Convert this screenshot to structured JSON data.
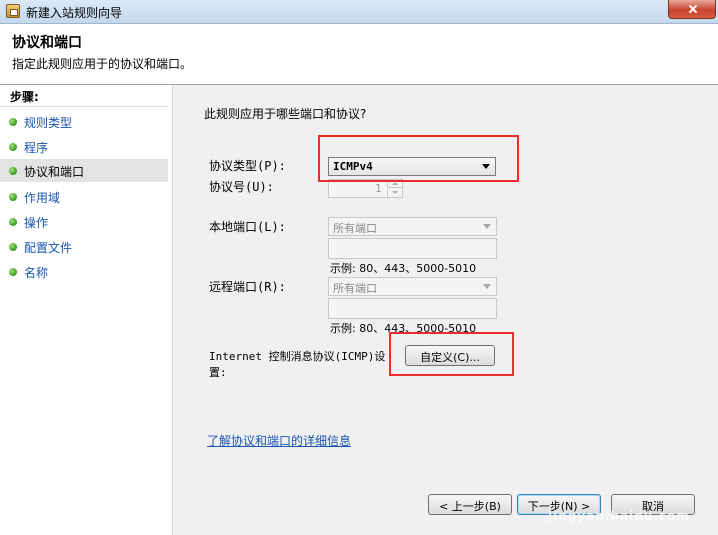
{
  "window": {
    "title": "新建入站规则向导"
  },
  "header": {
    "title": "协议和端口",
    "subtitle": "指定此规则应用于的协议和端口。"
  },
  "steps": {
    "title": "步骤:",
    "items": [
      {
        "label": "规则类型"
      },
      {
        "label": "程序"
      },
      {
        "label": "协议和端口"
      },
      {
        "label": "作用域"
      },
      {
        "label": "操作"
      },
      {
        "label": "配置文件"
      },
      {
        "label": "名称"
      }
    ],
    "selected_label": "协议和端口"
  },
  "form": {
    "question": "此规则应用于哪些端口和协议?",
    "protocol_type_label": "协议类型(P):",
    "protocol_type_value": "ICMPv4",
    "protocol_number_label": "协议号(U):",
    "protocol_number_value": "1",
    "local_port_label": "本地端口(L):",
    "local_port_value": "所有端口",
    "local_port_example": "示例: 80、443、5000-5010",
    "remote_port_label": "远程端口(R):",
    "remote_port_value": "所有端口",
    "remote_port_example": "示例: 80、443、5000-5010",
    "icmp_label_line1": "Internet 控制消息协议(ICMP)设",
    "icmp_label_line2": "置:",
    "customize_button": "自定义(C)..."
  },
  "link": {
    "text": "了解协议和端口的详细信息"
  },
  "buttons": {
    "back": "< 上一步(B)",
    "next": "下一步(N) >",
    "cancel": "取消"
  },
  "watermark": "jingyan.baidu.com",
  "colors": {
    "highlight": "#e8302a",
    "link": "#1a56b0",
    "step_selected_bg": "#e3e3e3"
  }
}
